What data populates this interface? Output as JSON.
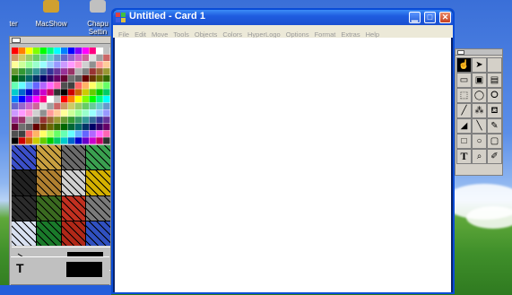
{
  "desktop": {
    "icons": [
      {
        "label": "ter"
      },
      {
        "label": "MacShow"
      },
      {
        "label": "Chapu\nSettin"
      }
    ]
  },
  "window": {
    "title": "Untitled - Card 1",
    "menu": [
      "File",
      "Edit",
      "Move",
      "Tools",
      "Objects",
      "Colors",
      "HyperLogo",
      "Options",
      "Format",
      "Extras",
      "Help"
    ]
  },
  "left_panel": {
    "palette_rows": [
      [
        "#ff0000",
        "#ff8000",
        "#ffff00",
        "#80ff00",
        "#00ff00",
        "#00ff80",
        "#00ffff",
        "#0080ff",
        "#0000ff",
        "#8000ff",
        "#ff00ff",
        "#ff0080",
        "#ffffff",
        "#c0c0c0"
      ],
      [
        "#cc6666",
        "#cc9966",
        "#cccc66",
        "#99cc66",
        "#66cc66",
        "#66cc99",
        "#66cccc",
        "#6699cc",
        "#6666cc",
        "#9966cc",
        "#cc66cc",
        "#cc6699",
        "#e0e0e0",
        "#a0a0a0"
      ],
      [
        "#ff9999",
        "#ffcc99",
        "#ffff99",
        "#ccff99",
        "#99ff99",
        "#99ffcc",
        "#99ffff",
        "#99ccff",
        "#9999ff",
        "#cc99ff",
        "#ff99ff",
        "#ff99cc",
        "#d0d0d0",
        "#909090"
      ],
      [
        "#993333",
        "#996633",
        "#999933",
        "#669933",
        "#339933",
        "#339966",
        "#339999",
        "#336699",
        "#333399",
        "#663399",
        "#993399",
        "#993366",
        "#b0b0b0",
        "#808080"
      ],
      [
        "#660000",
        "#663300",
        "#666600",
        "#336600",
        "#006600",
        "#006633",
        "#006666",
        "#003366",
        "#000066",
        "#330066",
        "#660066",
        "#660033",
        "#707070",
        "#606060"
      ],
      [
        "#ff6666",
        "#ffb366",
        "#ffff66",
        "#b3ff66",
        "#66ff66",
        "#66ffb3",
        "#66ffff",
        "#66b3ff",
        "#6666ff",
        "#b366ff",
        "#ff66ff",
        "#ff66b3",
        "#505050",
        "#404040"
      ],
      [
        "#cc0000",
        "#cc6600",
        "#cccc00",
        "#66cc00",
        "#00cc00",
        "#00cc66",
        "#00cccc",
        "#0066cc",
        "#0000cc",
        "#6600cc",
        "#cc00cc",
        "#cc0066",
        "#303030",
        "#000000"
      ]
    ],
    "patterns": [
      "#3b4fc8",
      "#c8a040",
      "#6a6a6a",
      "#3aa050",
      "#222222",
      "#b08030",
      "#d0d0d0",
      "#d4b000",
      "#2b2b2b",
      "#3a6a20",
      "#c03020",
      "#7a7a7a",
      "#d8e0f0",
      "#1a7a2a",
      "#b02818",
      "#3050c0"
    ],
    "tools": [
      {
        "icon": "line-tool-icon",
        "swatch": "#000000"
      },
      {
        "icon": "eraser-tool-icon",
        "swatch": "#ffffff"
      },
      {
        "icon": "text-tool-icon",
        "glyph": "T",
        "swatch": "#000000"
      }
    ]
  },
  "right_panel": {
    "tools": [
      {
        "name": "hand-tool-icon",
        "glyph": "☝",
        "selected": true
      },
      {
        "name": "arrow-tool-icon",
        "glyph": "➤",
        "selected": false
      },
      {
        "name": "blank-tool-icon",
        "glyph": "",
        "selected": false
      },
      {
        "name": "button-tool-icon",
        "glyph": "▭",
        "selected": false
      },
      {
        "name": "image-tool-icon",
        "glyph": "▣",
        "selected": false
      },
      {
        "name": "field-tool-icon",
        "glyph": "▤",
        "selected": false
      },
      {
        "name": "rect-select-tool-icon",
        "glyph": "⬚",
        "selected": false
      },
      {
        "name": "oval-select-tool-icon",
        "glyph": "◯",
        "selected": false
      },
      {
        "name": "lasso-tool-icon",
        "glyph": "ⵔ",
        "selected": false
      },
      {
        "name": "brush-tool-icon",
        "glyph": "╱",
        "selected": false
      },
      {
        "name": "spray-tool-icon",
        "glyph": "⁂",
        "selected": false
      },
      {
        "name": "fill-tool-icon",
        "glyph": "⛾",
        "selected": false
      },
      {
        "name": "eraser-tool-icon",
        "glyph": "◢",
        "selected": false
      },
      {
        "name": "line-tool-icon",
        "glyph": "╲",
        "selected": false
      },
      {
        "name": "pencil-tool-icon",
        "glyph": "✎",
        "selected": false
      },
      {
        "name": "rectangle-tool-icon",
        "glyph": "□",
        "selected": false
      },
      {
        "name": "oval-tool-icon",
        "glyph": "○",
        "selected": false
      },
      {
        "name": "rounded-rect-tool-icon",
        "glyph": "▢",
        "selected": false
      },
      {
        "name": "text-tool-icon",
        "glyph": "T",
        "selected": false
      },
      {
        "name": "zoom-tool-icon",
        "glyph": "⌕",
        "selected": false
      },
      {
        "name": "eyedropper-tool-icon",
        "glyph": "✐",
        "selected": false
      }
    ]
  }
}
